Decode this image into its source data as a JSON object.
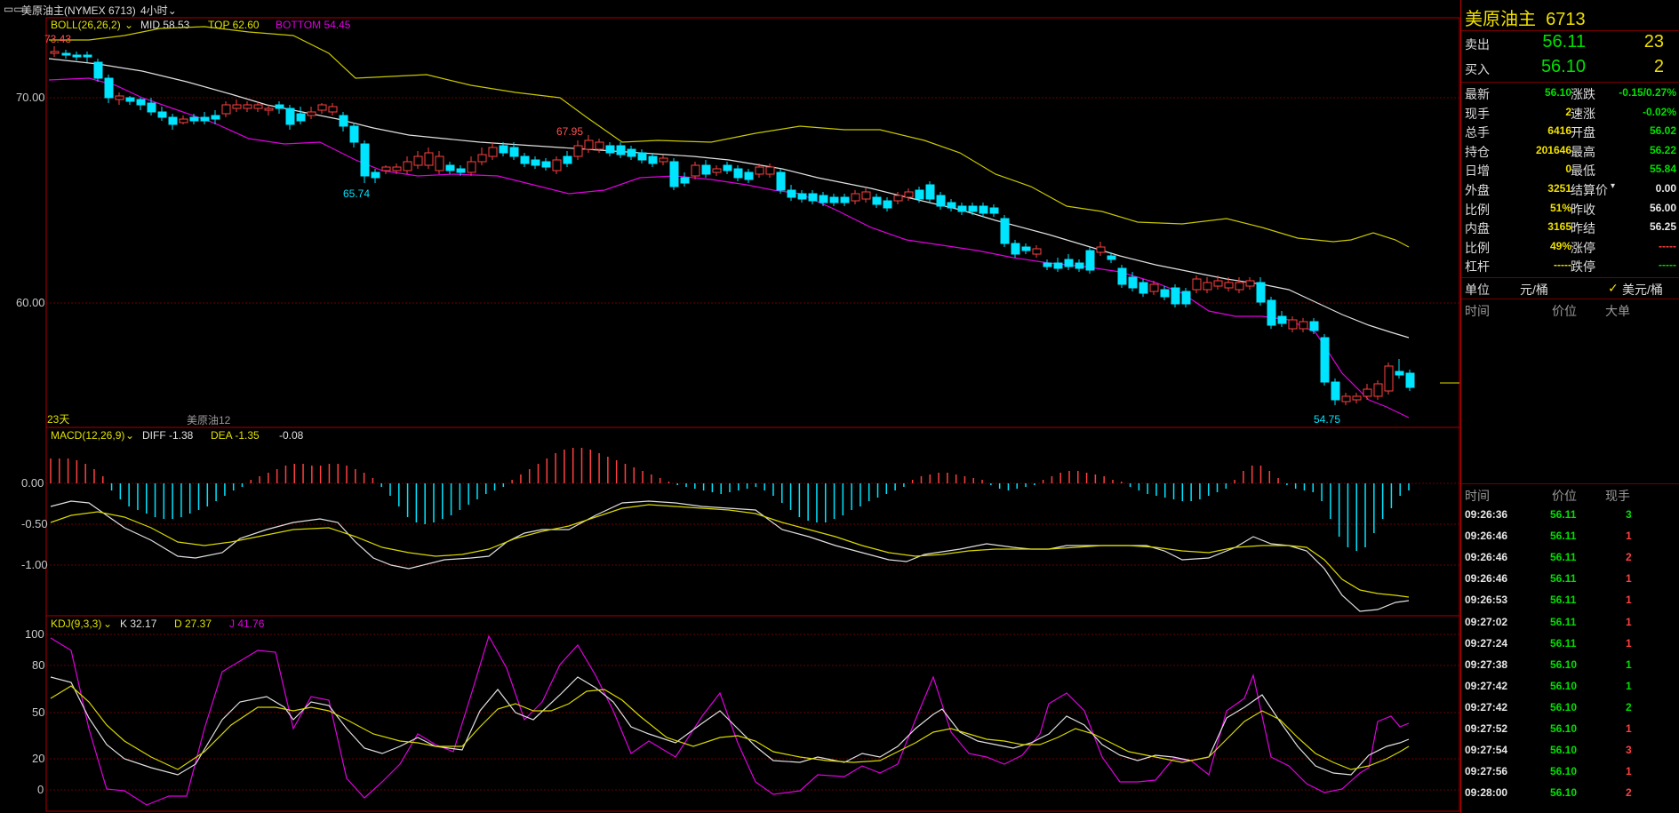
{
  "window": {
    "symbol_title": "美原油主(NYMEX 6713)",
    "period": "4小时"
  },
  "boll": {
    "name": "BOLL(26,26,2)",
    "mid": "MID 58.53",
    "top": "TOP 62.60",
    "bottom": "BOTTOM 54.45"
  },
  "price_panel": {
    "y_labels": [
      "70.00",
      "60.00"
    ],
    "hi_label": "73.43",
    "lo_label_1": "65.74",
    "mid_label": "67.95",
    "lo_label_2": "54.75",
    "days_label": "23天",
    "contract_label": "美原油12"
  },
  "macd": {
    "name": "MACD(12,26,9)",
    "diff": "DIFF -1.38",
    "dea": "DEA -1.35",
    "macd": "-0.08",
    "y_labels": [
      "0.00",
      "-0.50",
      "-1.00"
    ]
  },
  "kdj": {
    "name": "KDJ(9,3,3)",
    "k": "K 32.17",
    "d": "D 27.37",
    "j": "J 41.76",
    "y_labels": [
      "100",
      "80",
      "50",
      "20",
      "0"
    ]
  },
  "quote": {
    "title": "美原油主",
    "code": "6713",
    "sell_label": "卖出",
    "sell_price": "56.11",
    "sell_vol": "23",
    "buy_label": "买入",
    "buy_price": "56.10",
    "buy_vol": "2",
    "rows": [
      {
        "l1": "最新",
        "v1": "56.10",
        "l2": "涨跌",
        "v2": "-0.15/0.27%"
      },
      {
        "l1": "现手",
        "v1": "2",
        "l2": "速涨",
        "v2": "-0.02%"
      },
      {
        "l1": "总手",
        "v1": "6416",
        "l2": "开盘",
        "v2": "56.02"
      },
      {
        "l1": "持仓",
        "v1": "201646",
        "l2": "最高",
        "v2": "56.22"
      },
      {
        "l1": "日增",
        "v1": "0",
        "l2": "最低",
        "v2": "55.84"
      },
      {
        "l1": "外盘",
        "v1": "3251",
        "l2": "结算价",
        "v2": "0.00"
      },
      {
        "l1": "比例",
        "v1": "51%",
        "l2": "昨收",
        "v2": "56.00"
      },
      {
        "l1": "内盘",
        "v1": "3165",
        "l2": "昨结",
        "v2": "56.25"
      },
      {
        "l1": "比例",
        "v1": "49%",
        "l2": "涨停",
        "v2": "-----"
      },
      {
        "l1": "杠杆",
        "v1": "-----",
        "l2": "跌停",
        "v2": "-----"
      }
    ],
    "unit_label": "单位",
    "unit_opt1": "元/桶",
    "unit_opt2": "美元/桶",
    "big_header": {
      "time": "时间",
      "price": "价位",
      "big": "大单"
    }
  },
  "ticks_header": {
    "time": "时间",
    "price": "价位",
    "vol": "现手"
  },
  "ticks": [
    {
      "time": "09:26:36",
      "price": "56.11",
      "vol": "3"
    },
    {
      "time": "09:26:46",
      "price": "56.11",
      "vol": "1"
    },
    {
      "time": "09:26:46",
      "price": "56.11",
      "vol": "2"
    },
    {
      "time": "09:26:46",
      "price": "56.11",
      "vol": "1"
    },
    {
      "time": "09:26:53",
      "price": "56.11",
      "vol": "1"
    },
    {
      "time": "09:27:02",
      "price": "56.11",
      "vol": "1"
    },
    {
      "time": "09:27:24",
      "price": "56.11",
      "vol": "1"
    },
    {
      "time": "09:27:38",
      "price": "56.10",
      "vol": "1"
    },
    {
      "time": "09:27:42",
      "price": "56.10",
      "vol": "1"
    },
    {
      "time": "09:27:42",
      "price": "56.10",
      "vol": "2"
    },
    {
      "time": "09:27:52",
      "price": "56.10",
      "vol": "1"
    },
    {
      "time": "09:27:54",
      "price": "56.10",
      "vol": "3"
    },
    {
      "time": "09:27:56",
      "price": "56.10",
      "vol": "1"
    },
    {
      "time": "09:28:00",
      "price": "56.10",
      "vol": "2"
    }
  ],
  "colors": {
    "up": "#ff4040",
    "down": "#00e5ff",
    "mid": "#e0e0e0",
    "top": "#d8d800",
    "bottom": "#e000e0",
    "grid": "#7a0000",
    "green": "#00e000",
    "yellow": "#f0e000"
  }
}
